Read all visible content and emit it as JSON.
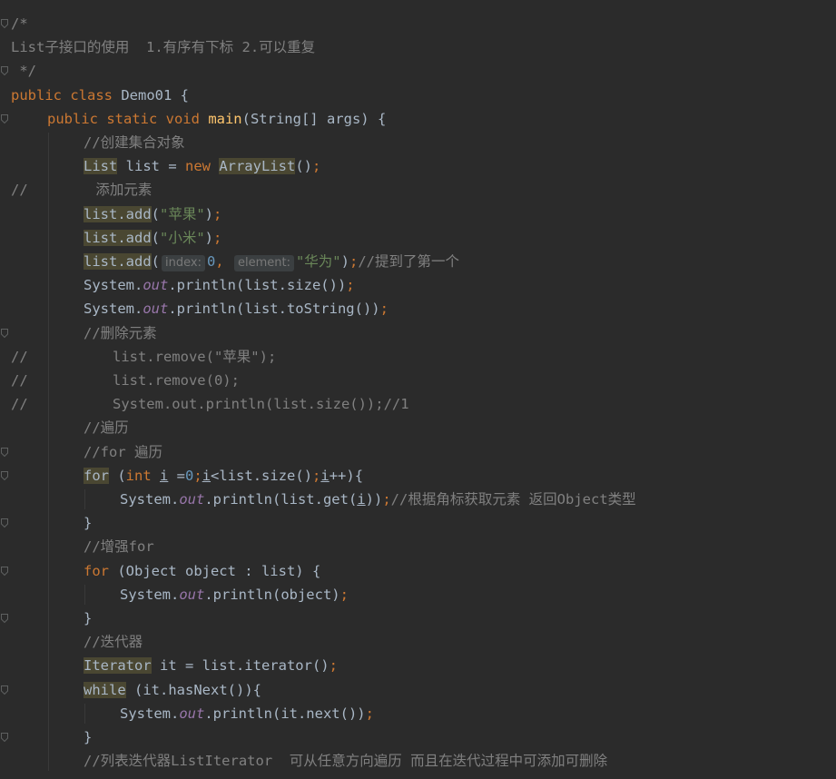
{
  "lines": [
    {
      "indent": 0,
      "fold": true,
      "parts": [
        [
          "cmt",
          "/*"
        ]
      ]
    },
    {
      "indent": 0,
      "parts": [
        [
          "cmt",
          "List子接口的使用  1.有序有下标 2.可以重复"
        ]
      ]
    },
    {
      "indent": 0,
      "fold": true,
      "parts": [
        [
          "cmt",
          " */"
        ]
      ]
    },
    {
      "indent": 0,
      "parts": [
        [
          "kw",
          "public class "
        ],
        [
          "plain",
          "Demo01 {"
        ]
      ]
    },
    {
      "indent": 1,
      "fold": true,
      "parts": [
        [
          "kw",
          "public static void "
        ],
        [
          "fn",
          "main"
        ],
        [
          "plain",
          "(String[] args) {"
        ]
      ]
    },
    {
      "indent": 2,
      "parts": [
        [
          "cmt",
          "//创建集合对象"
        ]
      ]
    },
    {
      "indent": 2,
      "parts": [
        [
          "hl",
          "List"
        ],
        [
          "plain",
          " list = "
        ],
        [
          "kw",
          "new "
        ],
        [
          "hl",
          "ArrayList"
        ],
        [
          "plain",
          "()"
        ],
        [
          "kw",
          ";"
        ]
      ]
    },
    {
      "indent": 0,
      "parts": [
        [
          "cmt",
          "//        添加元素"
        ]
      ]
    },
    {
      "indent": 2,
      "parts": [
        [
          "hl",
          "list.add"
        ],
        [
          "plain",
          "("
        ],
        [
          "str",
          "\"苹果\""
        ],
        [
          "plain",
          ")"
        ],
        [
          "kw",
          ";"
        ]
      ]
    },
    {
      "indent": 2,
      "parts": [
        [
          "hl",
          "list.add"
        ],
        [
          "plain",
          "("
        ],
        [
          "str",
          "\"小米\""
        ],
        [
          "plain",
          ")"
        ],
        [
          "kw",
          ";"
        ]
      ]
    },
    {
      "indent": 2,
      "parts": [
        [
          "hl",
          "list.add"
        ],
        [
          "plain",
          "("
        ],
        [
          "hint",
          "index:"
        ],
        [
          "num",
          "0"
        ],
        [
          "kw",
          ", "
        ],
        [
          "hint",
          "element:"
        ],
        [
          "str",
          "\"华为\""
        ],
        [
          "plain",
          ")"
        ],
        [
          "kw",
          ";"
        ],
        [
          "cmt",
          "//提到了第一个"
        ]
      ]
    },
    {
      "indent": 2,
      "parts": [
        [
          "plain",
          "System."
        ],
        [
          "fld",
          "out"
        ],
        [
          "plain",
          ".println(list.size())"
        ],
        [
          "kw",
          ";"
        ]
      ]
    },
    {
      "indent": 2,
      "parts": [
        [
          "plain",
          "System."
        ],
        [
          "fld",
          "out"
        ],
        [
          "plain",
          ".println(list.toString())"
        ],
        [
          "kw",
          ";"
        ]
      ]
    },
    {
      "indent": 2,
      "fold": true,
      "parts": [
        [
          "cmt",
          "//删除元素"
        ]
      ]
    },
    {
      "indent": 0,
      "parts": [
        [
          "cmt",
          "//          list.remove(\"苹果\");"
        ]
      ]
    },
    {
      "indent": 0,
      "parts": [
        [
          "cmt",
          "//          list.remove(0);"
        ]
      ]
    },
    {
      "indent": 0,
      "parts": [
        [
          "cmt",
          "//          System.out.println(list.size());//1"
        ]
      ]
    },
    {
      "indent": 2,
      "parts": [
        [
          "cmt",
          "//遍历"
        ]
      ]
    },
    {
      "indent": 2,
      "fold": true,
      "parts": [
        [
          "cmt",
          "//for 遍历"
        ]
      ]
    },
    {
      "indent": 2,
      "fold": true,
      "parts": [
        [
          "hl",
          "for"
        ],
        [
          "plain",
          " ("
        ],
        [
          "kw",
          "int "
        ],
        [
          "ul",
          "i"
        ],
        [
          "plain",
          " ="
        ],
        [
          "num",
          "0"
        ],
        [
          "kw",
          ";"
        ],
        [
          "ul",
          "i"
        ],
        [
          "plain",
          "<list.size()"
        ],
        [
          "kw",
          ";"
        ],
        [
          "ul",
          "i"
        ],
        [
          "plain",
          "++){"
        ]
      ]
    },
    {
      "indent": 3,
      "parts": [
        [
          "plain",
          "System."
        ],
        [
          "fld",
          "out"
        ],
        [
          "plain",
          ".println(list.get("
        ],
        [
          "ul",
          "i"
        ],
        [
          "plain",
          "))"
        ],
        [
          "kw",
          ";"
        ],
        [
          "cmt",
          "//根据角标获取元素 返回Object类型"
        ]
      ]
    },
    {
      "indent": 2,
      "fold": true,
      "parts": [
        [
          "plain",
          "}"
        ]
      ]
    },
    {
      "indent": 2,
      "parts": [
        [
          "cmt",
          "//增强for"
        ]
      ]
    },
    {
      "indent": 2,
      "fold": true,
      "parts": [
        [
          "kw",
          "for "
        ],
        [
          "plain",
          "(Object object : list) {"
        ]
      ]
    },
    {
      "indent": 3,
      "parts": [
        [
          "plain",
          "System."
        ],
        [
          "fld",
          "out"
        ],
        [
          "plain",
          ".println(object)"
        ],
        [
          "kw",
          ";"
        ]
      ]
    },
    {
      "indent": 2,
      "fold": true,
      "parts": [
        [
          "plain",
          "}"
        ]
      ]
    },
    {
      "indent": 2,
      "parts": [
        [
          "cmt",
          "//迭代器"
        ]
      ]
    },
    {
      "indent": 2,
      "parts": [
        [
          "hl",
          "Iterator"
        ],
        [
          "plain",
          " it = list.iterator()"
        ],
        [
          "kw",
          ";"
        ]
      ]
    },
    {
      "indent": 2,
      "fold": true,
      "parts": [
        [
          "hl",
          "while"
        ],
        [
          "plain",
          " (it.hasNext()){"
        ]
      ]
    },
    {
      "indent": 3,
      "parts": [
        [
          "plain",
          "System."
        ],
        [
          "fld",
          "out"
        ],
        [
          "plain",
          ".println(it.next())"
        ],
        [
          "kw",
          ";"
        ]
      ]
    },
    {
      "indent": 2,
      "fold": true,
      "parts": [
        [
          "plain",
          "}"
        ]
      ]
    },
    {
      "indent": 2,
      "parts": [
        [
          "cmt",
          "//列表迭代器ListIterator  可从任意方向遍历 而且在迭代过程中可添加可删除"
        ]
      ]
    }
  ],
  "colors": {
    "background": "#2b2b2b",
    "default": "#a9b7c6",
    "keyword": "#cc7832",
    "string": "#6a8759",
    "number": "#6897bb",
    "field": "#9876aa",
    "method": "#ffc66d",
    "comment": "#808080"
  }
}
